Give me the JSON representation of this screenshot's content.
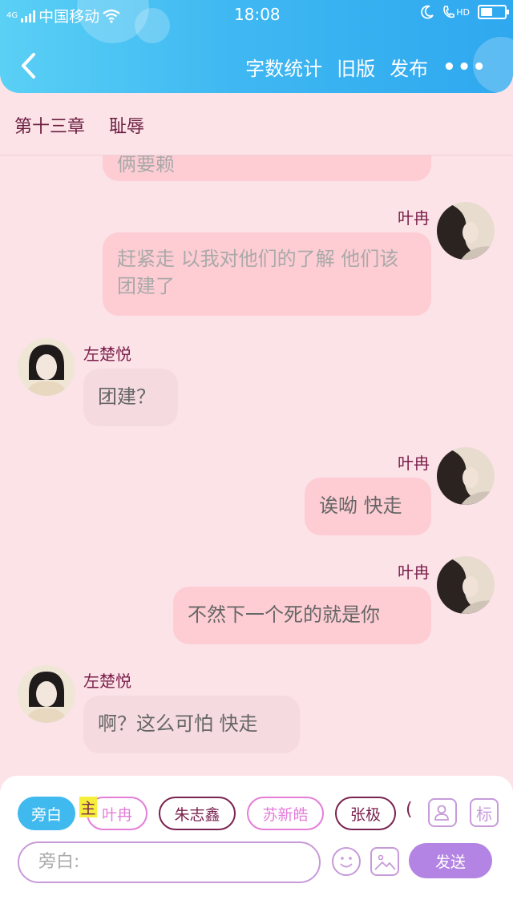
{
  "status_bar": {
    "network": "4G",
    "carrier": "中国移动",
    "time": "18:08",
    "hd": "HD"
  },
  "header": {
    "back_icon": "chevron-left-icon",
    "actions": [
      "字数统计",
      "旧版",
      "发布"
    ],
    "more": "•••"
  },
  "chapter": {
    "number": "第十三章",
    "title": "耻辱"
  },
  "messages": [
    {
      "side": "right",
      "name": "",
      "text": "俩要赖",
      "faded": true
    },
    {
      "side": "right",
      "name": "叶冉",
      "text": "赶紧走 以我对他们的了解 他们该团建了",
      "faded": true
    },
    {
      "side": "left",
      "name": "左楚悦",
      "text": "团建？",
      "faded": false
    },
    {
      "side": "right",
      "name": "叶冉",
      "text": "诶呦 快走",
      "faded": false
    },
    {
      "side": "right",
      "name": "叶冉",
      "text": "不然下一个死的就是你",
      "faded": false
    },
    {
      "side": "left",
      "name": "左楚悦",
      "text": "啊？这么可怕 快走",
      "faded": false
    }
  ],
  "composer": {
    "characters": [
      "旁白",
      "叶冉",
      "朱志鑫",
      "苏新皓",
      "张极"
    ],
    "active_character": "旁白",
    "badge": "主",
    "partial_chip": "(",
    "tag_label": "标",
    "input_placeholder": "旁白:",
    "send_label": "发送"
  },
  "colors": {
    "header_blue": "#3fb8f2",
    "background_pink": "#fbe3e8",
    "bubble_right": "#fecdd4",
    "bubble_left": "#f5dbe0",
    "name_color": "#7a1d49",
    "send_purple": "#b384e3"
  }
}
